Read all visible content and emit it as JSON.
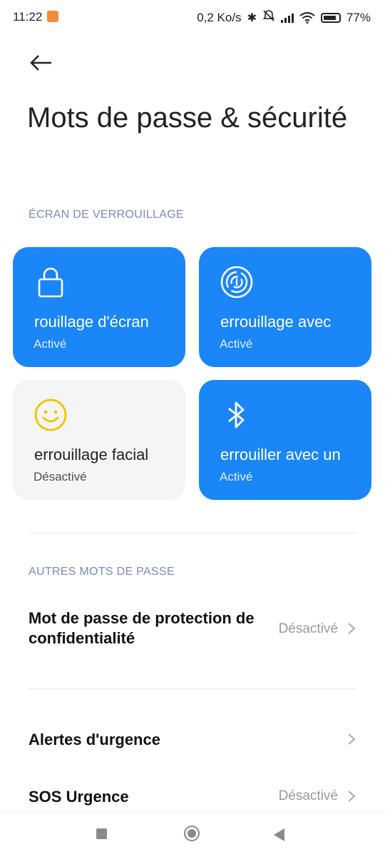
{
  "status_bar": {
    "time": "11:22",
    "network_speed": "0,2 Ko/s",
    "battery": "77%",
    "icons": [
      "notification-icon",
      "bluetooth-icon",
      "bell-muted-icon",
      "signal-icon",
      "wifi-icon",
      "battery-icon"
    ]
  },
  "header": {
    "back_icon": "back-arrow-icon",
    "title": "Mots de passe & sécurité"
  },
  "lock_screen": {
    "section_label": "ÉCRAN DE VERROUILLAGE",
    "tiles": [
      {
        "name": "Verrouillage d'écran",
        "visible_text": "rouillage d'écran",
        "state": "Activé",
        "icon": "lock-icon",
        "style": "blue"
      },
      {
        "name": "Déverrouillage avec empreinte",
        "visible_text": "errouillage avec",
        "state": "Activé",
        "icon": "fingerprint-icon",
        "style": "blue"
      },
      {
        "name": "Déverrouillage facial",
        "visible_text": "errouillage facial",
        "state": "Désactivé",
        "icon": "face-icon",
        "style": "gray"
      },
      {
        "name": "Déverrouiller avec un appareil",
        "visible_text": "errouiller avec un",
        "state": "Activé",
        "icon": "bluetooth-icon",
        "style": "blue"
      }
    ]
  },
  "other_passwords": {
    "section_label": "AUTRES MOTS DE PASSE",
    "items": [
      {
        "label": "Mot de passe de protection de confidentialité",
        "value": "Désactivé"
      },
      {
        "label": "Alertes d'urgence",
        "value": ""
      },
      {
        "label": "SOS Urgence",
        "value": "Désactivé"
      }
    ]
  },
  "colors": {
    "accent": "#1a86f7",
    "section_label": "#7a89b8",
    "tile_gray": "#f5f5f5",
    "face_icon": "#f2c200"
  }
}
